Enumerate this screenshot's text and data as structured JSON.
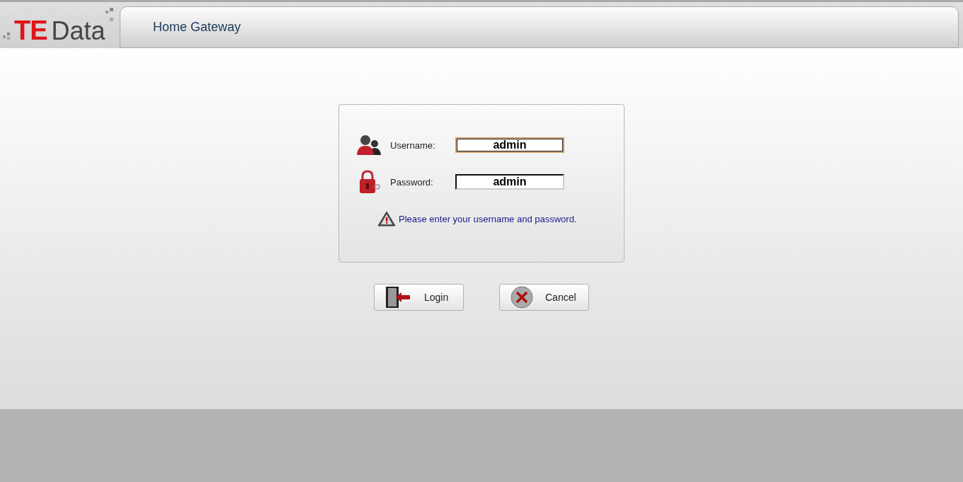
{
  "logo": {
    "mark": "TE",
    "word": "Data"
  },
  "header": {
    "title": "Home Gateway"
  },
  "login": {
    "fields": [
      {
        "kind": "user",
        "label": "Username:",
        "value": "admin",
        "focused": true
      },
      {
        "kind": "lock",
        "label": "Password:",
        "value": "admin",
        "focused": false
      }
    ],
    "message": "Please enter your username and password."
  },
  "buttons": [
    {
      "kind": "login",
      "label": "Login"
    },
    {
      "kind": "cancel",
      "label": "Cancel"
    }
  ]
}
